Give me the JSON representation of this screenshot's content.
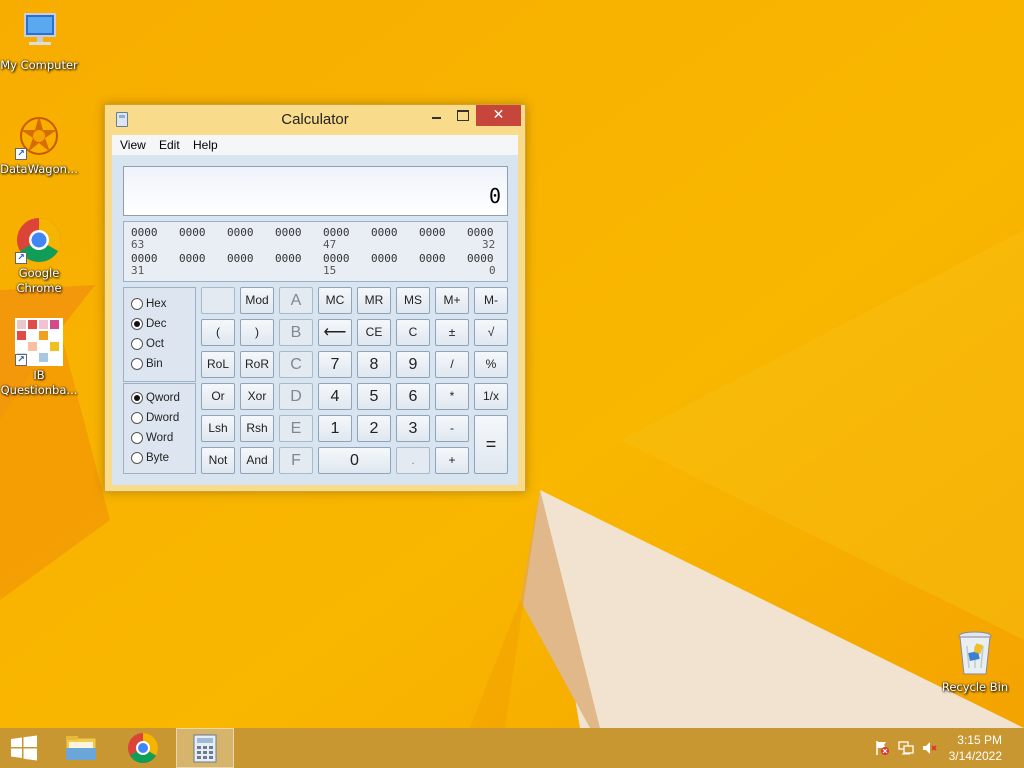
{
  "desktop": {
    "icons": [
      {
        "label": "My Computer",
        "icon": "computer-icon"
      },
      {
        "label": "DataWagon...",
        "icon": "datawagon-icon"
      },
      {
        "label": "Google Chrome",
        "icon": "chrome-icon"
      },
      {
        "label": "IB Questionba...",
        "icon": "ib-questionbank-icon"
      }
    ],
    "recycle_bin": {
      "label": "Recycle Bin",
      "icon": "recycle-bin-icon"
    }
  },
  "window": {
    "title": "Calculator",
    "close_glyph": "✕",
    "menu": [
      "View",
      "Edit",
      "Help"
    ]
  },
  "display": {
    "value": "0"
  },
  "bits": {
    "row1": [
      "0000",
      "0000",
      "0000",
      "0000",
      "0000",
      "0000",
      "0000",
      "0000"
    ],
    "row1_labels": [
      "63",
      "47",
      "32"
    ],
    "row2": [
      "0000",
      "0000",
      "0000",
      "0000",
      "0000",
      "0000",
      "0000",
      "0000"
    ],
    "row2_labels": [
      "31",
      "15",
      "0"
    ]
  },
  "number_base": {
    "options": [
      "Hex",
      "Dec",
      "Oct",
      "Bin"
    ],
    "selected": "Dec"
  },
  "word_size": {
    "options": [
      "Qword",
      "Dword",
      "Word",
      "Byte"
    ],
    "selected": "Qword"
  },
  "buttons": {
    "blank": "",
    "mod": "Mod",
    "A": "A",
    "MC": "MC",
    "MR": "MR",
    "MS": "MS",
    "Mplus": "M+",
    "Mminus": "M-",
    "lparen": "(",
    "rparen": ")",
    "B": "B",
    "back": "⟵",
    "CE": "CE",
    "C": "C",
    "plusminus": "±",
    "sqrt": "√",
    "RoL": "RoL",
    "RoR": "RoR",
    "Cbtn": "C",
    "n7": "7",
    "n8": "8",
    "n9": "9",
    "div": "/",
    "pct": "%",
    "Or": "Or",
    "Xor": "Xor",
    "D": "D",
    "n4": "4",
    "n5": "5",
    "n6": "6",
    "mul": "*",
    "recip": "1/x",
    "Lsh": "Lsh",
    "Rsh": "Rsh",
    "E": "E",
    "n1": "1",
    "n2": "2",
    "n3": "3",
    "sub": "-",
    "eq": "=",
    "Not": "Not",
    "And": "And",
    "F": "F",
    "n0": "0",
    "dot": ".",
    "add": "+"
  },
  "taskbar": {
    "items": [
      "start-icon",
      "file-explorer-icon",
      "chrome-icon",
      "calculator-icon"
    ],
    "time": "3:15 PM",
    "date": "3/14/2022"
  },
  "colors": {
    "accent": "#f5a500",
    "close": "#c7463b"
  }
}
